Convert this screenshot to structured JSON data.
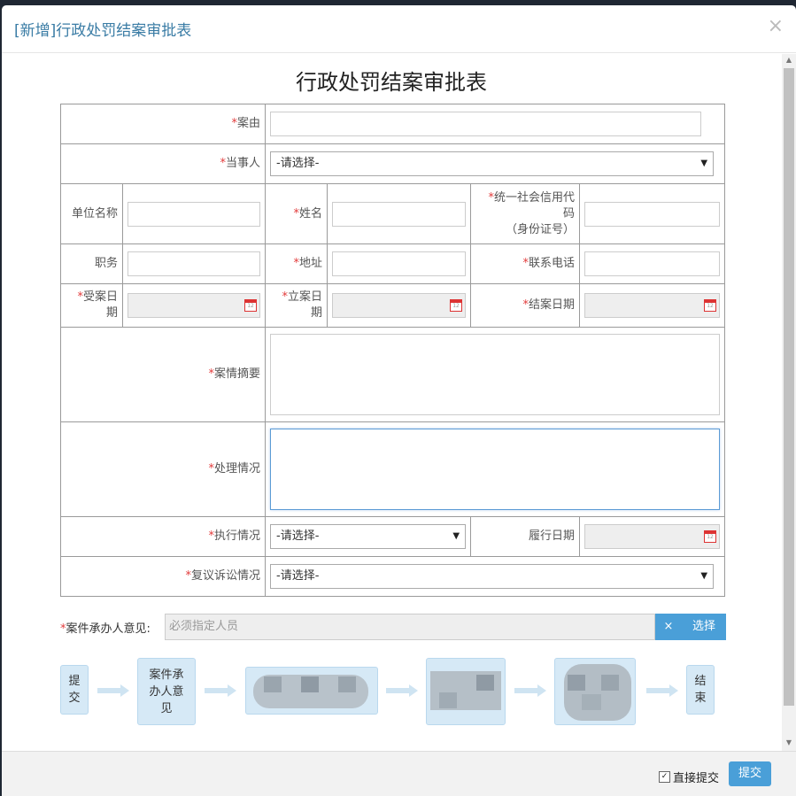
{
  "modal": {
    "title": "[新增]行政处罚结案审批表",
    "close": "×"
  },
  "form": {
    "title": "行政处罚结案审批表",
    "required_mark": "*",
    "case_reason": {
      "label": "案由",
      "value": ""
    },
    "party": {
      "label": "当事人",
      "value": "-请选择-"
    },
    "unit_name": {
      "label": "单位名称",
      "value": ""
    },
    "name": {
      "label": "姓名",
      "value": ""
    },
    "credit_code": {
      "label_line1": "统一社会信用代",
      "label_line2": "码",
      "label_line3": "（身份证号）",
      "value": ""
    },
    "position": {
      "label": "职务",
      "value": ""
    },
    "address": {
      "label": "地址",
      "value": ""
    },
    "phone": {
      "label": "联系电话",
      "value": ""
    },
    "accept_date": {
      "label_line1": "受案日",
      "label_line2": "期",
      "value": ""
    },
    "filing_date": {
      "label_line1": "立案日",
      "label_line2": "期",
      "value": ""
    },
    "close_date": {
      "label": "结案日期",
      "value": ""
    },
    "case_summary": {
      "label": "案情摘要",
      "value": ""
    },
    "handling": {
      "label": "处理情况",
      "value": ""
    },
    "execution": {
      "label": "执行情况",
      "value": "-请选择-"
    },
    "perform_date": {
      "label": "履行日期",
      "value": ""
    },
    "review": {
      "label": "复议诉讼情况",
      "value": "-请选择-"
    },
    "calendar_icon_text": "12"
  },
  "opinion": {
    "label": "案件承办人意见:",
    "placeholder": "必须指定人员",
    "clear": "×",
    "choose": "选择"
  },
  "flow": {
    "start": [
      "提",
      "交"
    ],
    "step1": [
      "案件承",
      "办人意",
      "见"
    ],
    "end": [
      "结",
      "束"
    ]
  },
  "footer": {
    "direct_submit": "直接提交",
    "direct_submit_checked": true,
    "checkmark": "✓",
    "submit": "提交"
  },
  "colors": {
    "accent": "#4a9fd8",
    "title": "#3a7ca5",
    "required": "#e23b3b",
    "flow_node": "#d6e9f6"
  }
}
